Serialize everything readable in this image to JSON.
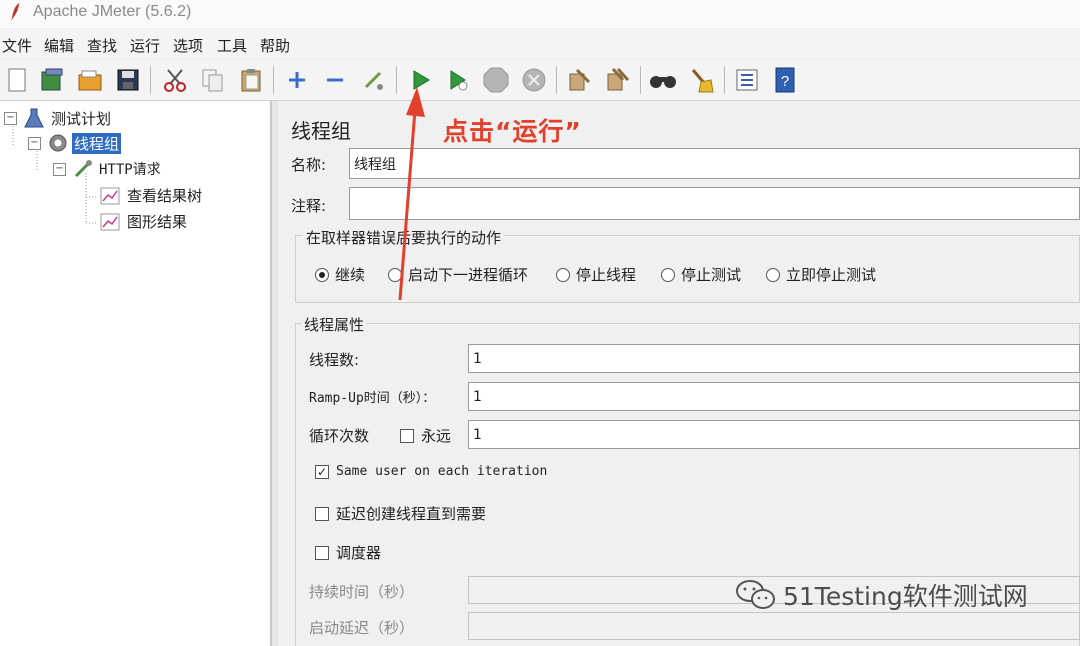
{
  "app": {
    "title": "Apache JMeter (5.6.2)"
  },
  "menu": [
    "文件",
    "编辑",
    "查找",
    "运行",
    "选项",
    "工具",
    "帮助"
  ],
  "toolbar": {
    "icons": [
      "new-icon",
      "templates-icon",
      "open-icon",
      "save-icon",
      "cut-icon",
      "copy-icon",
      "paste-icon",
      "expand-icon",
      "collapse-icon",
      "toggle-icon",
      "start-icon",
      "start-no-pause-icon",
      "stop-icon",
      "shutdown-icon",
      "clear-icon",
      "clear-all-icon",
      "search-icon",
      "reset-search-icon",
      "function-helper-icon",
      "help-icon"
    ]
  },
  "tree": {
    "test_plan": "测试计划",
    "thread_group": "线程组",
    "http_request": "HTTP请求",
    "view_results_tree": "查看结果树",
    "graph_results": "图形结果"
  },
  "panel": {
    "title": "线程组",
    "name_label": "名称:",
    "name_value": "线程组",
    "comment_label": "注释:",
    "comment_value": "",
    "error_action": {
      "title": "在取样器错误后要执行的动作",
      "options": [
        "继续",
        "启动下一进程循环",
        "停止线程",
        "停止测试",
        "立即停止测试"
      ],
      "selected": "继续"
    },
    "thread_props": {
      "title": "线程属性",
      "threads_label": "线程数:",
      "threads_value": "1",
      "rampup_label": "Ramp-Up时间（秒）：",
      "rampup_value": "1",
      "loop_label": "循环次数",
      "forever_label": "永远",
      "forever_checked": false,
      "loop_value": "1",
      "same_user_label": "Same user on each iteration",
      "same_user_checked": true,
      "delay_label": "延迟创建线程直到需要",
      "delay_checked": false,
      "scheduler_label": "调度器",
      "scheduler_checked": false,
      "duration_label": "持续时间（秒）",
      "startup_delay_label": "启动延迟（秒）"
    }
  },
  "annotation": {
    "text": "点击“运行”",
    "color": "#e2402d"
  },
  "watermark": {
    "text": "51Testing软件测试网"
  }
}
